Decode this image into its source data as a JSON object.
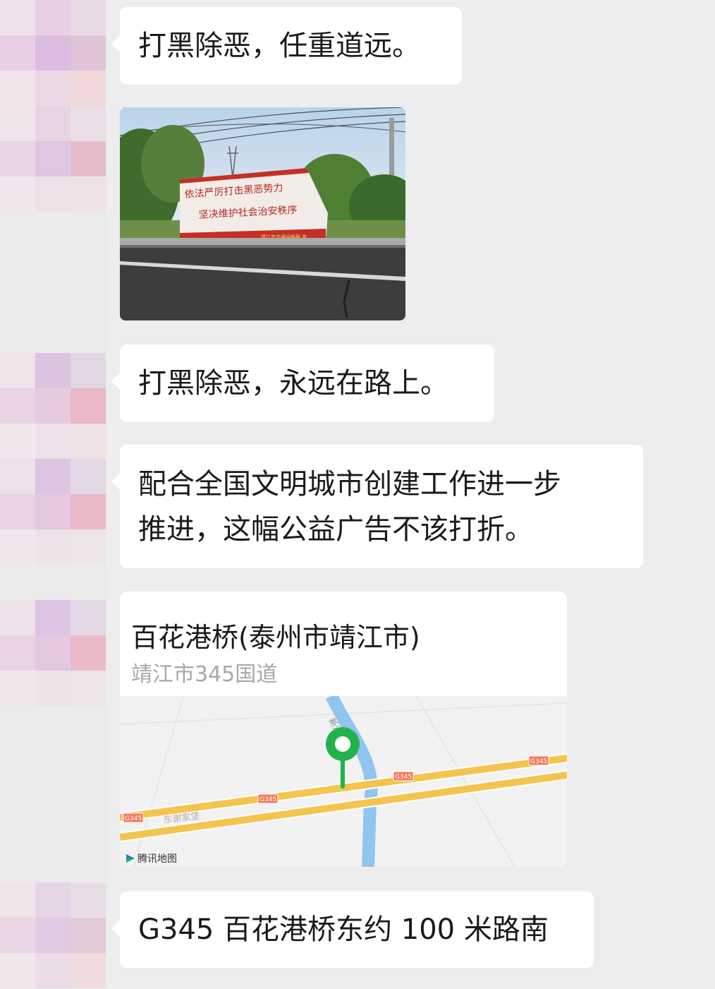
{
  "messages": [
    {
      "type": "text",
      "text": "打黑除恶，任重道远。"
    },
    {
      "type": "image",
      "image": {
        "banner_line1": "依法严厉打击黑恶势力",
        "banner_line2": "坚决维护社会治安秩序",
        "banner_footer": "靖江市交通运输局 宣"
      }
    },
    {
      "type": "text",
      "text": "打黑除恶，永远在路上。"
    },
    {
      "type": "text",
      "lines": [
        "配合全国文明城市创建工作进一步",
        "推进，这幅公益广告不该打折。"
      ]
    },
    {
      "type": "location",
      "name": "百花港桥(泰州市靖江市)",
      "address": "靖江市345国道",
      "map": {
        "road_labels": [
          "G345",
          "G345",
          "G345",
          "G345"
        ],
        "place_label": "东谢家垡",
        "river_label": "新港河",
        "credit": "腾讯地图",
        "pin_color": "#22b24c",
        "road_color": "#f3c54f",
        "river_color": "#8fc5ee"
      }
    },
    {
      "type": "text",
      "text": "G345 百花港桥东约 100 米路南"
    }
  ],
  "colors": {
    "background": "#ededed",
    "bubble": "#ffffff",
    "text": "#1a1a1a",
    "secondary_text": "#a8a8a8"
  }
}
